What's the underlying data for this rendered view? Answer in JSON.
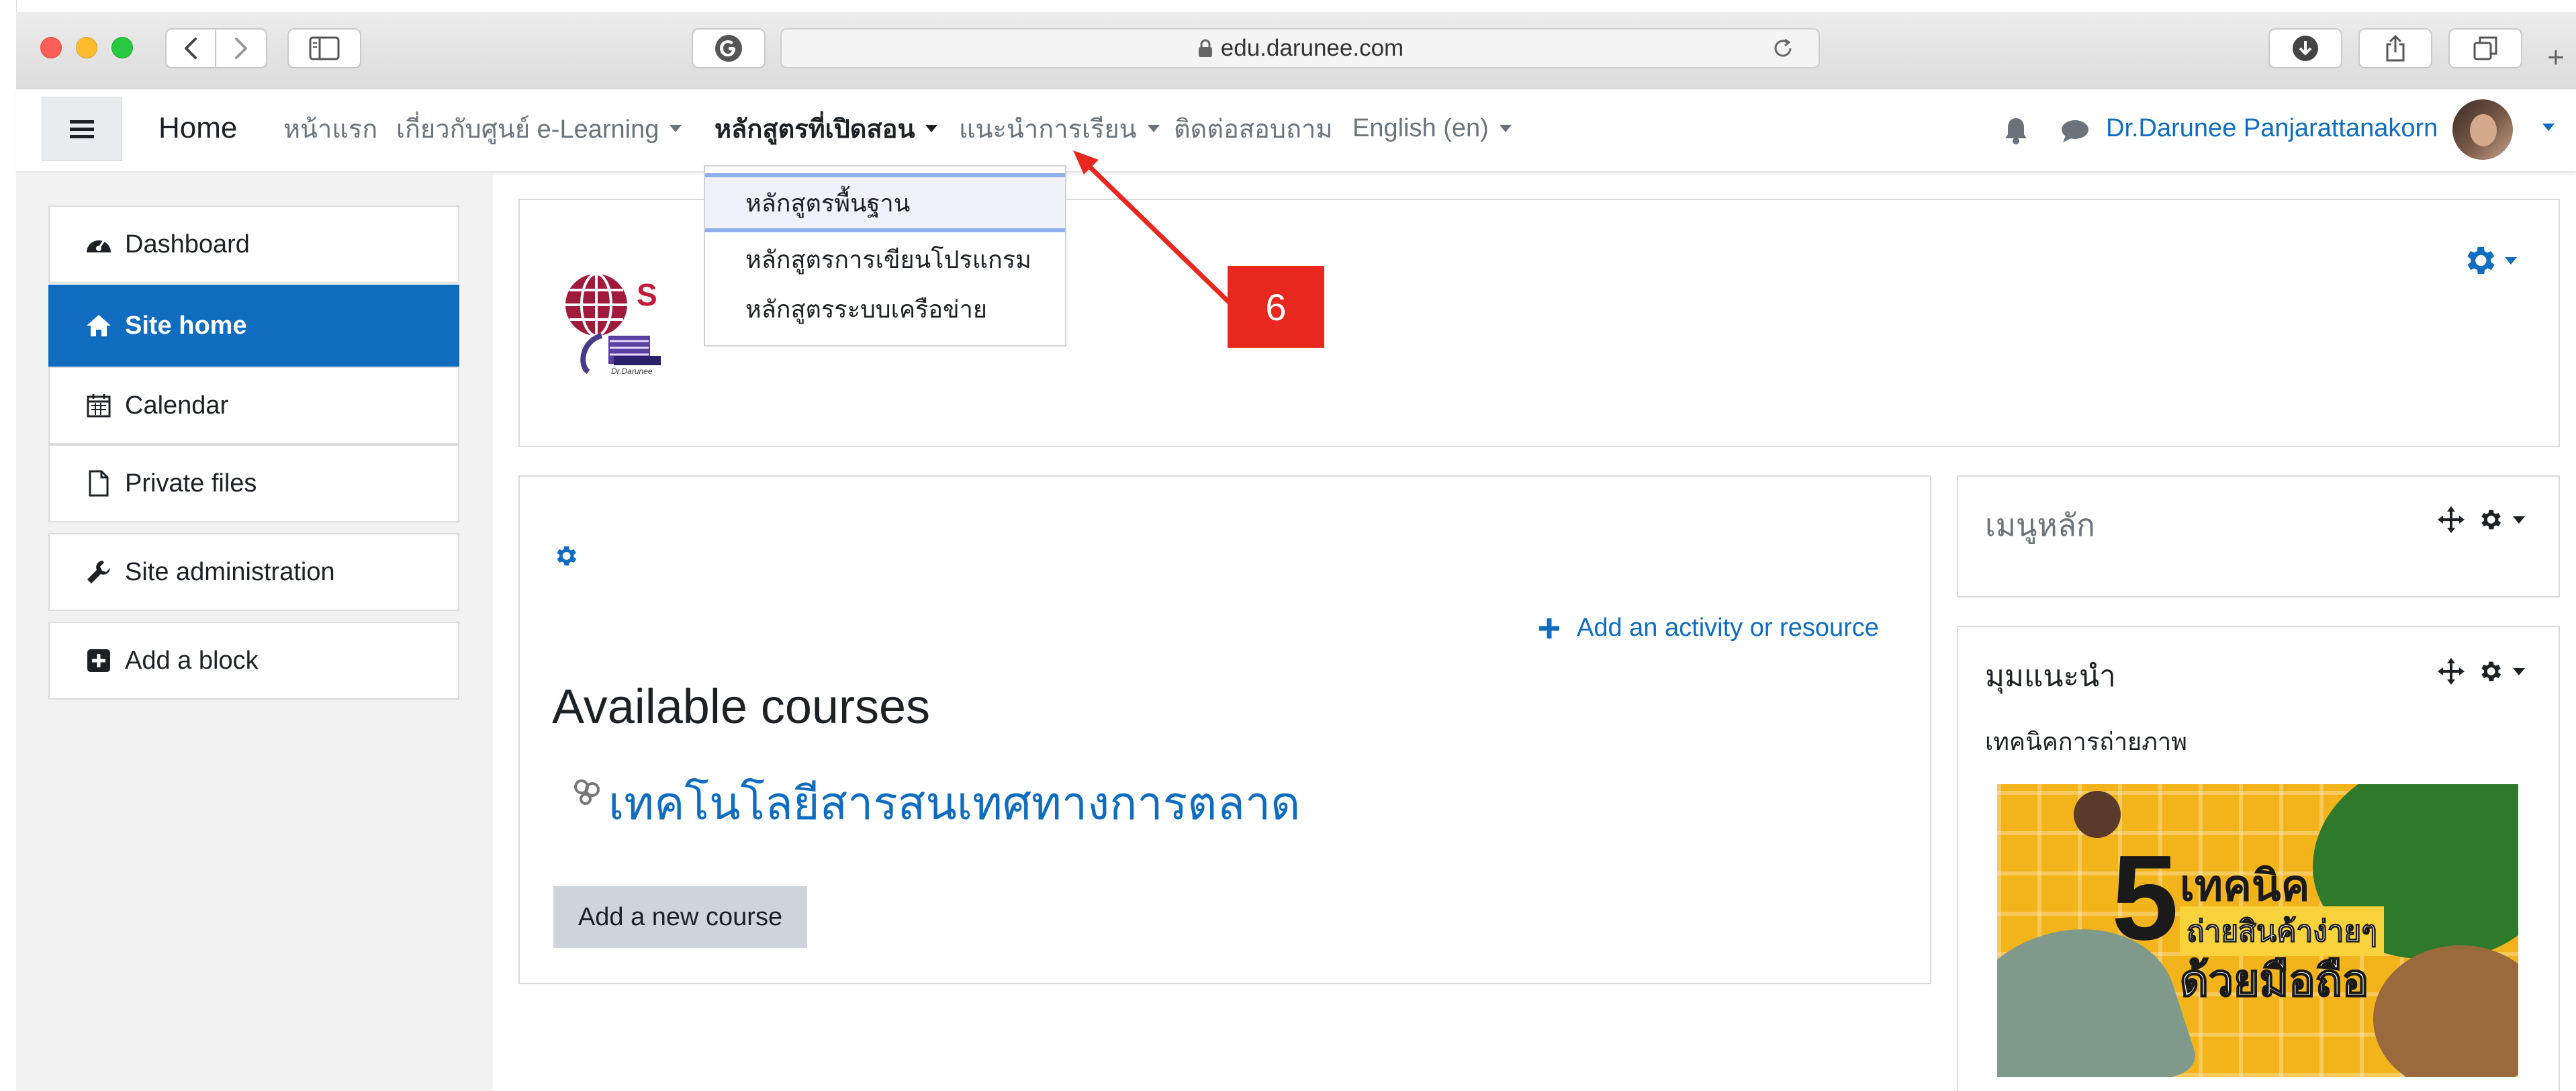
{
  "browser": {
    "url": "edu.darunee.com",
    "new_tab": "+"
  },
  "navbar": {
    "brand": "Home",
    "items": [
      {
        "label": "หน้าแรก"
      },
      {
        "label": "เกี่ยวกับศูนย์ e-Learning"
      },
      {
        "label": "หลักสูตรที่เปิดสอน"
      },
      {
        "label": "แนะนำการเรียน"
      },
      {
        "label": "ติดต่อสอบถาม"
      },
      {
        "label": "English (en)"
      }
    ],
    "user_name": "Dr.Darunee Panjarattanakorn"
  },
  "dropdown": {
    "items": [
      {
        "label": "หลักสูตรพื้นฐาน"
      },
      {
        "label": "หลักสูตรการเขียนโปรแกรม"
      },
      {
        "label": "หลักสูตรระบบเครือข่าย"
      }
    ]
  },
  "annotation": {
    "number": "6",
    "color": "#e8281e"
  },
  "sidebar": {
    "items": [
      {
        "label": "Dashboard",
        "icon": "dashboard-icon"
      },
      {
        "label": "Site home",
        "icon": "home-icon"
      },
      {
        "label": "Calendar",
        "icon": "calendar-icon"
      },
      {
        "label": "Private files",
        "icon": "file-icon"
      },
      {
        "label": "Site administration",
        "icon": "wrench-icon"
      },
      {
        "label": "Add a block",
        "icon": "plus-square-icon"
      }
    ]
  },
  "logo": {
    "letters": "S",
    "caption": "Dr.Darunee"
  },
  "main": {
    "add_activity": "Add an activity or resource",
    "available_courses": "Available courses",
    "course_name": "เทคโนโลยีสารสนเทศทางการตลาด",
    "add_course": "Add a new course"
  },
  "blocks": {
    "menu_title": "เมนูหลัก",
    "recommend_title": "มุมแนะนำ",
    "recommend_subtitle": "เทคนิคการถ่ายภาพ",
    "banner": {
      "big_number": "5",
      "line1": "เทคนิค",
      "line2": "ถ่ายสินค้าง่ายๆ",
      "line3": "ด้วยมือถือ"
    }
  },
  "colors": {
    "accent": "#0f6cbf",
    "annotation": "#e8281e",
    "banner_yellow": "#f3b41b"
  }
}
